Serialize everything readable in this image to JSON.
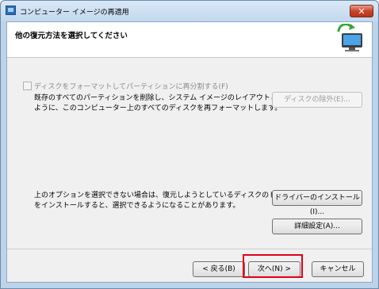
{
  "window": {
    "title": "コンピューター イメージの再適用",
    "close_glyph": "✕"
  },
  "header": {
    "title": "他の復元方法を選択してください",
    "graphic": "computer-restore-icon"
  },
  "options": {
    "format_checkbox_label": "ディスクをフォーマットしてパーティションに再分割する(F)",
    "format_checked": false,
    "format_description_line1": "既存のすべてのパーティションを削除し、システム イメージのレイアウトと一致する",
    "format_description_line2": "ように、このコンピューター上のすべてのディスクを再フォーマットします。",
    "exclude_disks_button": "ディスクの除外(E)...",
    "driver_description_line1": "上のオプションを選択できない場合は、復元しようとしているディスクのドライバー",
    "driver_description_line2": "をインストールすると、選択できるようになることがあります。",
    "install_driver_button": "ドライバーのインストール(I)...",
    "advanced_button": "詳細設定(A)..."
  },
  "footer": {
    "back_button": "< 戻る(B)",
    "next_button": "次へ(N) >",
    "cancel_button": "キャンセル"
  },
  "colors": {
    "highlight": "#e0001a",
    "frame": "#bcd3ea"
  }
}
